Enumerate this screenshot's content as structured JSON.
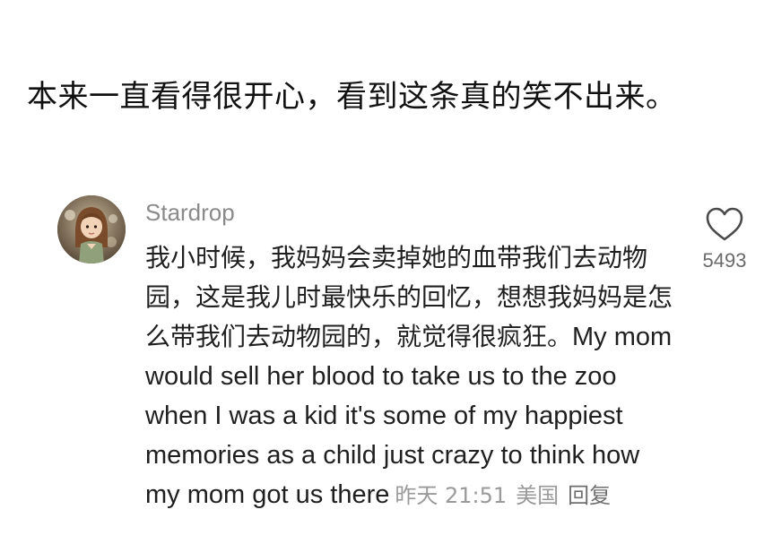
{
  "post": {
    "caption": "本来一直看得很开心，看到这条真的笑不出来。"
  },
  "comment": {
    "username": "Stardrop",
    "text_zh": "我小时候，我妈妈会卖掉她的血带我们去动物园，这是我儿时最快乐的回忆，想想我妈妈是怎么带我们去动物园的，就觉得很疯狂。",
    "text_en": "My mom would sell her blood to take us to the zoo when I was a kid it's some of my happiest memories as a child just crazy to think how my mom got us there",
    "time": "昨天 21:51",
    "location": "美国",
    "reply_label": "回复",
    "like_count": "5493",
    "like_icon": "heart-outline-icon",
    "avatar_icon": "avatar-girl-portrait"
  },
  "colors": {
    "username": "#8a8a8a",
    "meta": "#9a9a9a",
    "text": "#1f1f1f"
  }
}
